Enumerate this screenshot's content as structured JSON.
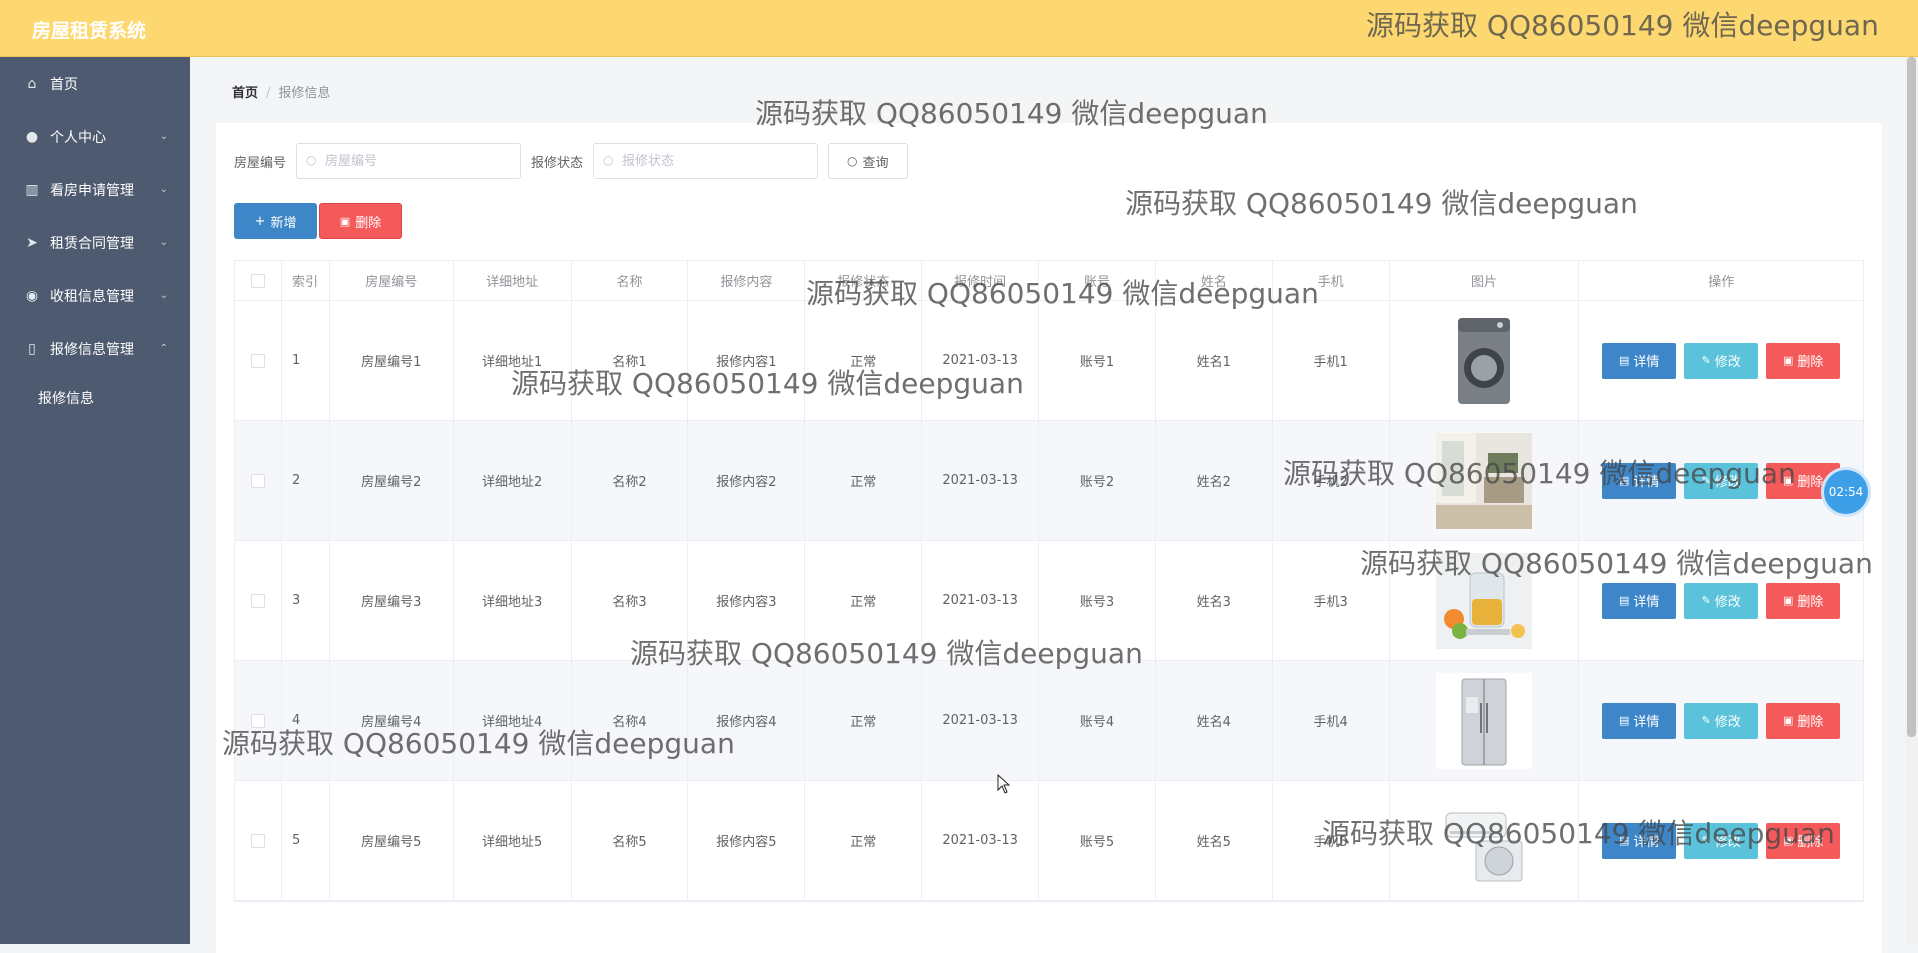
{
  "app": {
    "title": "房屋租赁系统"
  },
  "sidebar": {
    "items": [
      {
        "label": "首页",
        "icon": "home-icon"
      },
      {
        "label": "个人中心",
        "icon": "user-icon"
      },
      {
        "label": "看房申请管理",
        "icon": "building-icon"
      },
      {
        "label": "租赁合同管理",
        "icon": "send-icon"
      },
      {
        "label": "收租信息管理",
        "icon": "location-icon"
      },
      {
        "label": "报修信息管理",
        "icon": "phone-icon"
      }
    ],
    "sub_item": "报修信息"
  },
  "breadcrumb": {
    "home": "首页",
    "sep": "/",
    "current": "报修信息"
  },
  "search": {
    "house_label": "房屋编号",
    "house_placeholder": "房屋编号",
    "status_label": "报修状态",
    "status_placeholder": "报修状态",
    "query_label": "查询"
  },
  "actions": {
    "add_label": "新增",
    "delete_label": "删除"
  },
  "table": {
    "headers": [
      "索引",
      "房屋编号",
      "详细地址",
      "名称",
      "报修内容",
      "报修状态",
      "报修时间",
      "账号",
      "姓名",
      "手机",
      "图片",
      "操作"
    ],
    "rows": [
      {
        "idx": "1",
        "house": "房屋编号1",
        "addr": "详细地址1",
        "name": "名称1",
        "content": "报修内容1",
        "status": "正常",
        "time": "2021-03-13",
        "account": "账号1",
        "person": "姓名1",
        "phone": "手机1",
        "image": "washing-machine"
      },
      {
        "idx": "2",
        "house": "房屋编号2",
        "addr": "详细地址2",
        "name": "名称2",
        "content": "报修内容2",
        "status": "正常",
        "time": "2021-03-13",
        "account": "账号2",
        "person": "姓名2",
        "phone": "手机2",
        "image": "room-interior"
      },
      {
        "idx": "3",
        "house": "房屋编号3",
        "addr": "详细地址3",
        "name": "名称3",
        "content": "报修内容3",
        "status": "正常",
        "time": "2021-03-13",
        "account": "账号3",
        "person": "姓名3",
        "phone": "手机3",
        "image": "kettle"
      },
      {
        "idx": "4",
        "house": "房屋编号4",
        "addr": "详细地址4",
        "name": "名称4",
        "content": "报修内容4",
        "status": "正常",
        "time": "2021-03-13",
        "account": "账号4",
        "person": "姓名4",
        "phone": "手机4",
        "image": "refrigerator"
      },
      {
        "idx": "5",
        "house": "房屋编号5",
        "addr": "详细地址5",
        "name": "名称5",
        "content": "报修内容5",
        "status": "正常",
        "time": "2021-03-13",
        "account": "账号5",
        "person": "姓名5",
        "phone": "手机5",
        "image": "air-conditioner"
      }
    ],
    "ops": {
      "detail": "详情",
      "edit": "修改",
      "delete": "删除"
    }
  },
  "timer": "02:54",
  "watermark_text": "源码获取 QQ86050149 微信deepguan"
}
